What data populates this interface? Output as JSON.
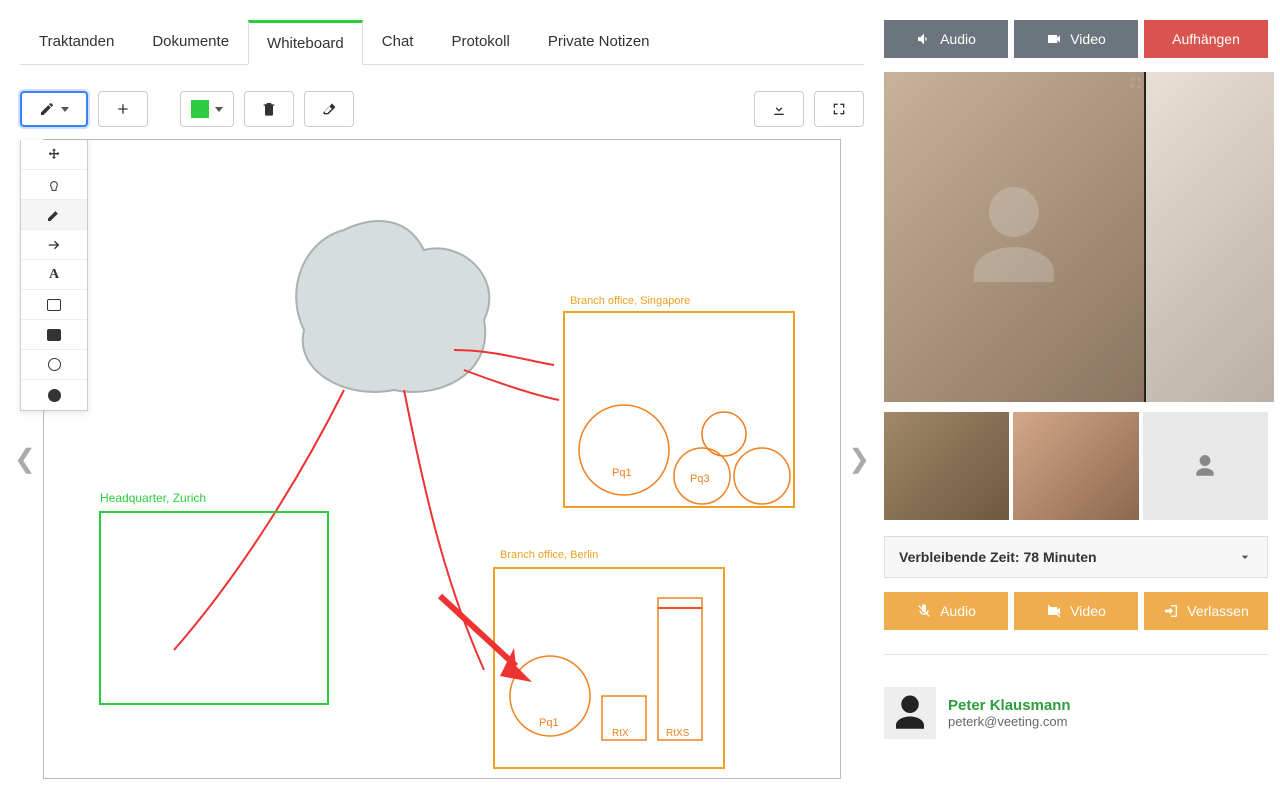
{
  "tabs": [
    "Traktanden",
    "Dokumente",
    "Whiteboard",
    "Chat",
    "Protokoll",
    "Private Notizen"
  ],
  "active_tab": 2,
  "toolbar": {
    "color": "#2ecc40"
  },
  "dropdown_tools": [
    "move",
    "laser",
    "pencil",
    "arrow",
    "text",
    "rect-outline",
    "rect-fill",
    "circle-outline",
    "circle-fill"
  ],
  "dropdown_active": 2,
  "whiteboard": {
    "hq": {
      "label": "Headquarter, Zurich"
    },
    "branch1": {
      "label": "Branch office, Singapore",
      "circles": [
        "Pq1",
        "Pq3"
      ]
    },
    "branch2": {
      "label": "Branch office, Berlin",
      "items": [
        "Pq1",
        "RtX",
        "RtXS"
      ]
    }
  },
  "controls_top": {
    "audio": "Audio",
    "video": "Video",
    "hangup": "Aufhängen"
  },
  "status": "Verbleibende Zeit: 78 Minuten",
  "controls_bottom": {
    "audio": "Audio",
    "video": "Video",
    "leave": "Verlassen"
  },
  "participants": [
    {
      "name": "Peter Klausmann",
      "email": "peterk@veeting.com"
    }
  ]
}
